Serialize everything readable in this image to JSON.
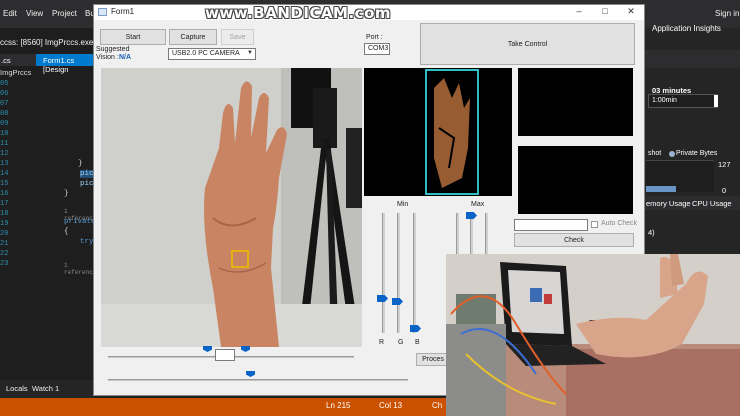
{
  "vs": {
    "menu": [
      "Edit",
      "View",
      "Project",
      "Bu"
    ],
    "sign_in": "Sign in",
    "app_insights": "Application Insights",
    "process": "ccss:  [8560] ImgPrccs.exe",
    "tabs": [
      ".cs",
      "Form1.cs [Design"
    ],
    "scope": "ImgPrccs",
    "line_numbers": [
      "05",
      "06",
      "07",
      "08",
      "09",
      "10",
      "11",
      "12",
      "13",
      "14",
      "15",
      "16",
      "17",
      "18",
      "19",
      "20",
      "21",
      "22",
      "23"
    ],
    "code": {
      "brace1": "}",
      "pic1": "pic",
      "pic2": "pic",
      "brace2": "}",
      "ref1": "1 referenc",
      "private": "private",
      "brace3": "{",
      "try": "try",
      "ref2": "1 referenc"
    },
    "bottom_tabs": [
      "Locals",
      "Watch 1"
    ],
    "status": {
      "ln": "Ln 215",
      "col": "Col 13",
      "ch": "Ch"
    },
    "diag": {
      "minutes": "03 minutes",
      "timeline": "1:00min",
      "snapshot": "shot",
      "private_bytes": "Private Bytes",
      "value_top": "127",
      "value_bottom": "0",
      "tabs": [
        "emory Usage",
        "CPU Usage"
      ],
      "item": "4)"
    }
  },
  "watermark": "www.BANDICAM.com",
  "form": {
    "title": "Form1",
    "controls": {
      "minimize": "–",
      "maximize": "□",
      "close": "✕"
    },
    "buttons": {
      "start": "Start",
      "capture": "Capture",
      "save": "Save",
      "take_control": "Take Control",
      "check": "Check",
      "process": "Proces"
    },
    "suggested_label": "Suggested",
    "vision_label": "Vision :",
    "vision_value": "N/A",
    "camera_select": "USB2.0 PC CAMERA",
    "port_label": "Port :",
    "port_value": "COM3",
    "min_label": "Min",
    "max_label": "Max",
    "rgb_labels": [
      "R",
      "G",
      "B"
    ],
    "auto_check": "Auto Check",
    "check_text": "",
    "center_text": ""
  },
  "icons": {
    "checkbox": "checkbox-icon",
    "dropdown": "chevron-down-icon",
    "form": "window-icon"
  }
}
